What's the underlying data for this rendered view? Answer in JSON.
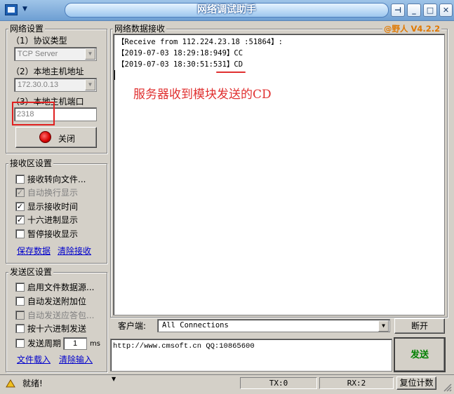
{
  "window": {
    "title": "网络调试助手",
    "brand": "@野人 V4.2.2"
  },
  "network_settings": {
    "group_label": "网络设置",
    "protocol_label": "（1）协议类型",
    "protocol_value": "TCP Server",
    "host_label": "（2）本地主机地址",
    "host_value": "172.30.0.13",
    "port_label": "（3）本地主机端口",
    "port_value": "2318",
    "close_button": "关闭"
  },
  "receive_settings": {
    "group_label": "接收区设置",
    "options": [
      {
        "label": "接收转向文件...",
        "checked": false,
        "disabled": false
      },
      {
        "label": "自动换行显示",
        "checked": true,
        "disabled": true
      },
      {
        "label": "显示接收时间",
        "checked": true,
        "disabled": false
      },
      {
        "label": "十六进制显示",
        "checked": true,
        "disabled": false
      },
      {
        "label": "暂停接收显示",
        "checked": false,
        "disabled": false
      }
    ],
    "save_link": "保存数据",
    "clear_link": "清除接收"
  },
  "send_settings": {
    "group_label": "发送区设置",
    "options": [
      {
        "label": "启用文件数据源...",
        "checked": false,
        "disabled": false
      },
      {
        "label": "自动发送附加位",
        "checked": false,
        "disabled": false
      },
      {
        "label": "自动发送应答包...",
        "checked": false,
        "disabled": true
      },
      {
        "label": "按十六进制发送",
        "checked": false,
        "disabled": false
      }
    ],
    "period_label": "发送周期",
    "period_value": "1",
    "period_unit": "ms",
    "load_link": "文件载入",
    "clear_link": "清除输入"
  },
  "receive_area": {
    "group_label": "网络数据接收",
    "lines": [
      "【Receive from 112.224.23.18 :51864】:",
      "【2019-07-03 18:29:18:949】CC",
      "【2019-07-03 18:30:51:531】CD"
    ],
    "annotation": "服务器收到模块发送的CD"
  },
  "client_bar": {
    "label": "客户端:",
    "value": "All Connections",
    "disconnect_button": "断开"
  },
  "send_area": {
    "text": "http://www.cmsoft.cn QQ:10865600",
    "send_button": "发送"
  },
  "status_bar": {
    "status": "就绪!",
    "tx": "TX:0",
    "rx": "RX:2",
    "reset_button": "复位计数"
  },
  "colors": {
    "brand": "#e07800",
    "annotation": "#e03030",
    "highlight_box": "#e02020",
    "send_button_text": "#008000"
  }
}
